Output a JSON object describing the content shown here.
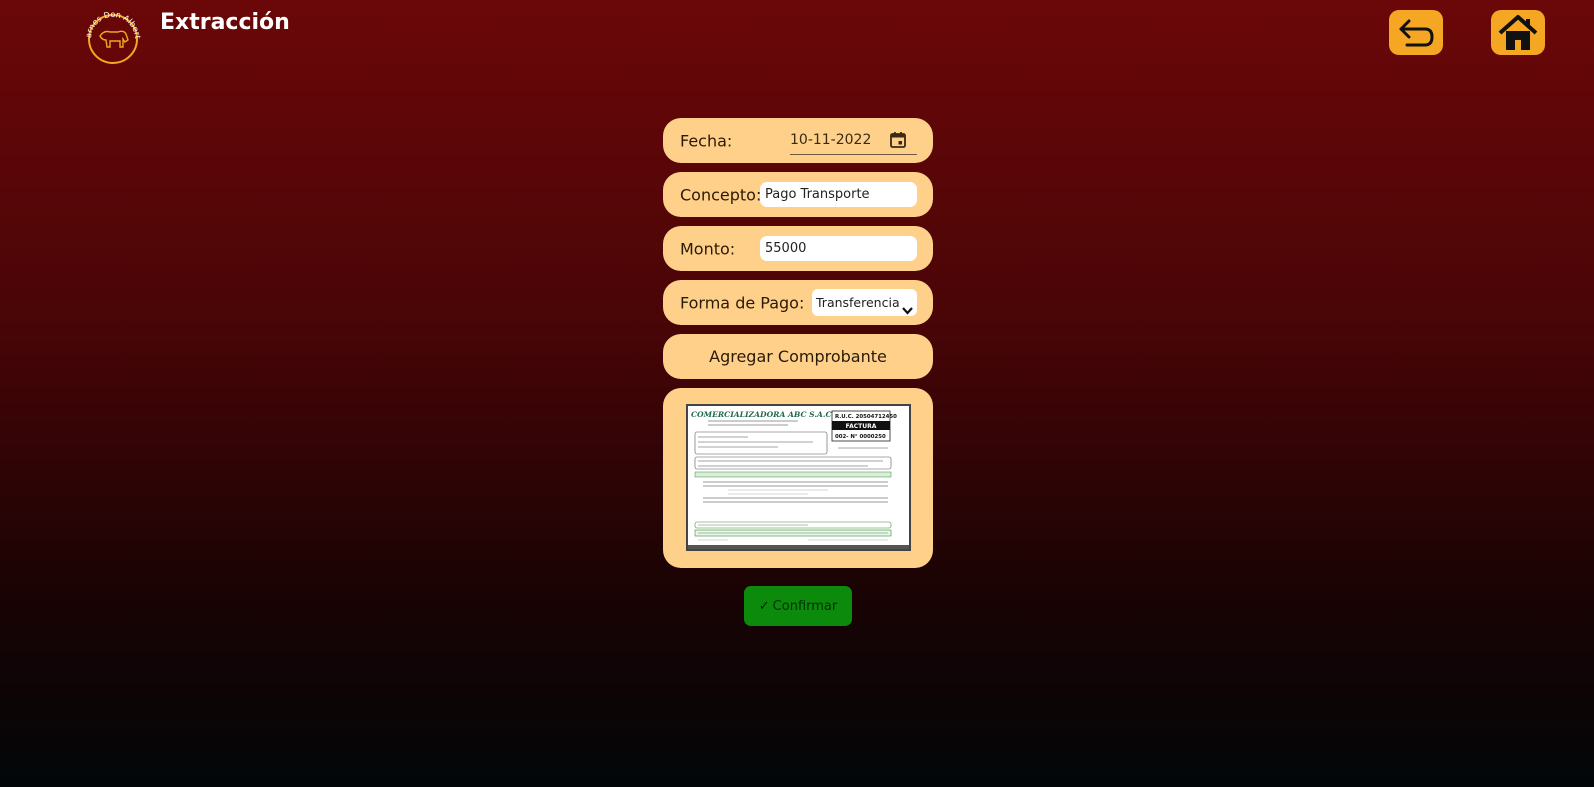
{
  "brand": {
    "logo_text": "Carnes Don Alberto"
  },
  "header": {
    "title": "Extracción"
  },
  "nav": {
    "back_icon": "back-arrow-icon",
    "home_icon": "home-icon",
    "accent_color": "#f5a623"
  },
  "form": {
    "fecha_label": "Fecha:",
    "fecha_value": "10-11-2022",
    "concepto_label": "Concepto:",
    "concepto_value": "Pago Transporte",
    "monto_label": "Monto:",
    "monto_value": "55000",
    "forma_label": "Forma de Pago:",
    "forma_value": "Transferencia",
    "agregar_label": "Agregar Comprobante",
    "confirm_label": "Confirmar",
    "card_color": "#ffd089",
    "confirm_color": "#0b8a0b"
  },
  "receipt": {
    "company": "COMERCIALIZADORA ABC S.A.C.",
    "ruc": "R.U.C. 20504712450",
    "doc_type": "FACTURA",
    "number": "002- N° 0000250"
  }
}
